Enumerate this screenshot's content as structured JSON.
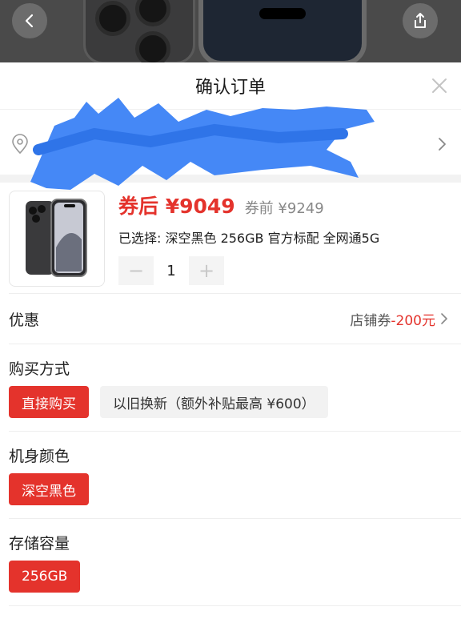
{
  "header": {
    "title": "确认订单"
  },
  "product": {
    "price_after": "券后 ¥9049",
    "price_before": "券前 ¥9249",
    "selected": "已选择: 深空黑色 256GB 官方标配 全网通5G",
    "quantity": "1",
    "minus": "−",
    "plus": "+"
  },
  "promo": {
    "label": "优惠",
    "store_label": "店铺券",
    "amount": "-200元"
  },
  "purchase": {
    "title": "购买方式",
    "options": [
      {
        "label": "直接购买",
        "selected": true
      },
      {
        "label": "以旧换新（额外补贴最高 ¥600）",
        "selected": false
      }
    ]
  },
  "color": {
    "title": "机身颜色",
    "options": [
      {
        "label": "深空黑色",
        "selected": true
      }
    ]
  },
  "storage": {
    "title": "存储容量",
    "options": [
      {
        "label": "256GB",
        "selected": true
      }
    ]
  },
  "colors": {
    "accent": "#e4332c",
    "scribble": "#3b82f6"
  },
  "icons": [
    "back-icon",
    "share-icon",
    "close-icon",
    "location-pin-icon",
    "chevron-right-icon"
  ]
}
